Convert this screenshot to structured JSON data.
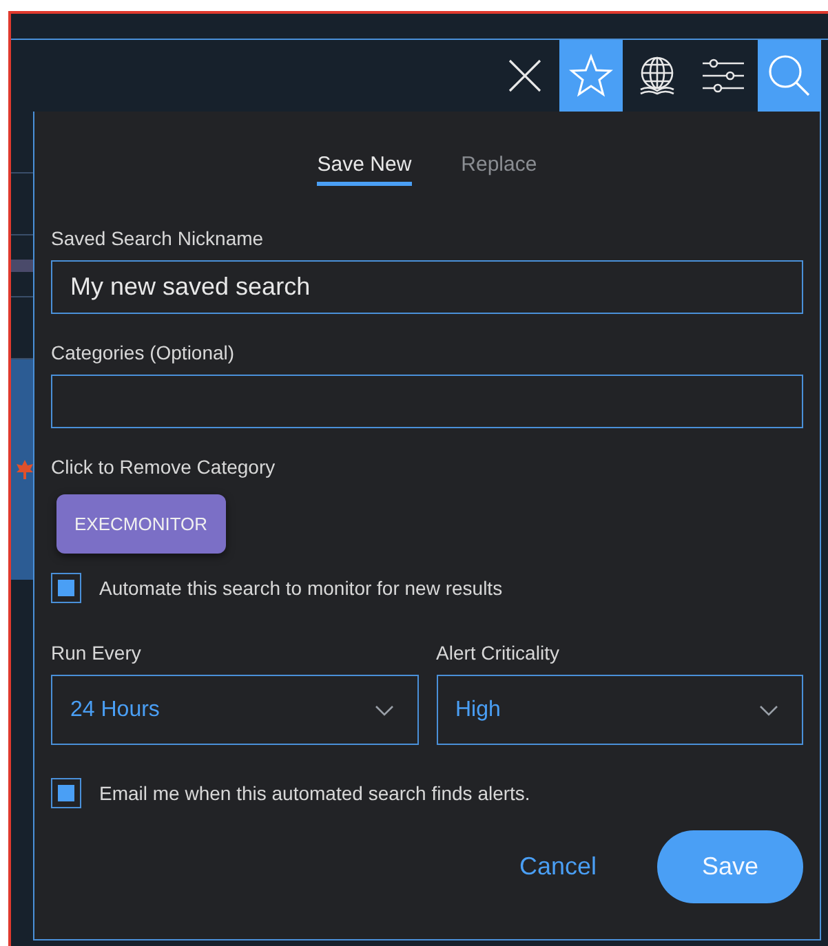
{
  "toolbar": [
    {
      "kind": "close",
      "selected": false
    },
    {
      "kind": "star",
      "selected": true
    },
    {
      "kind": "globe",
      "selected": false
    },
    {
      "kind": "sliders",
      "selected": false
    },
    {
      "kind": "search",
      "selected": true
    }
  ],
  "tabs": [
    {
      "label": "Save New",
      "selected": true
    },
    {
      "label": "Replace",
      "selected": false
    }
  ],
  "nickname": {
    "label": "Saved Search Nickname",
    "value": "My new saved search"
  },
  "categories": {
    "label": "Categories (Optional)"
  },
  "remove_hint": "Click to Remove Category",
  "chips": [
    {
      "label": "EXECMONITOR",
      "color": "#7b6fc6"
    }
  ],
  "automate": {
    "label": "Automate this search to monitor for new results",
    "checked": true
  },
  "run_every": {
    "label": "Run Every",
    "value": "24 Hours"
  },
  "criticality": {
    "label": "Alert Criticality",
    "value": "High"
  },
  "email": {
    "label": "Email me when this automated search finds alerts.",
    "checked": true
  },
  "buttons": {
    "cancel": "Cancel",
    "save": "Save"
  }
}
